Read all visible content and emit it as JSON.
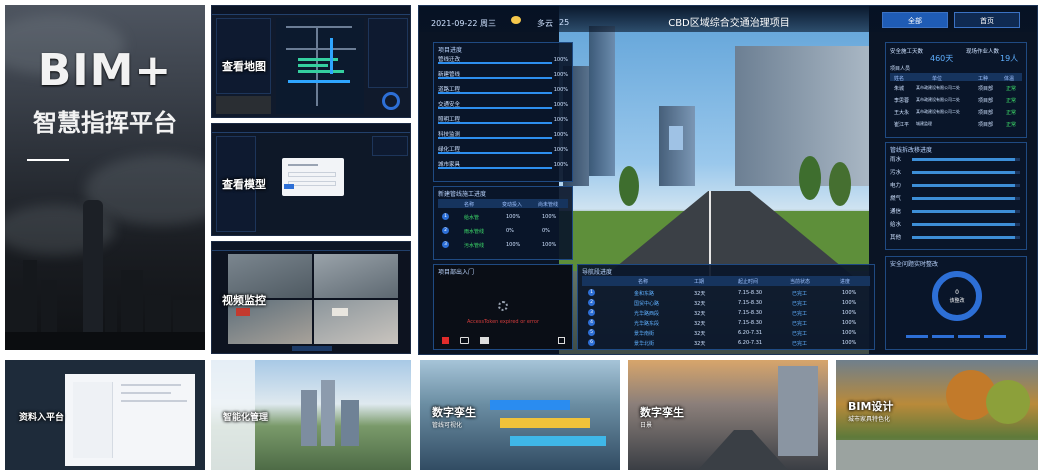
{
  "hero": {
    "title": "BIM+",
    "subtitle": "智慧指挥平台"
  },
  "modules": {
    "map": {
      "label": "查看地图"
    },
    "model": {
      "label": "查看模型"
    },
    "video": {
      "label": "视频监控"
    }
  },
  "dashboard": {
    "date": "2021-09-22 周三",
    "weather": "多云",
    "temperature": "25",
    "project_title": "CBD区域综合交通治理项目",
    "tabs": {
      "all": "全部",
      "home": "首页"
    },
    "project_progress": {
      "title": "项目进度",
      "items": [
        {
          "label": "管线迁改",
          "percent": "100%",
          "value": 1.0
        },
        {
          "label": "新建管线",
          "percent": "100%",
          "value": 1.0
        },
        {
          "label": "道路工程",
          "percent": "100%",
          "value": 1.0
        },
        {
          "label": "交通安全",
          "percent": "100%",
          "value": 1.0
        },
        {
          "label": "照明工程",
          "percent": "100%",
          "value": 1.0
        },
        {
          "label": "科技监测",
          "percent": "100%",
          "value": 1.0
        },
        {
          "label": "绿化工程",
          "percent": "100%",
          "value": 1.0
        },
        {
          "label": "城市家具",
          "percent": "100%",
          "value": 1.0
        }
      ]
    },
    "new_pipeline": {
      "title": "新建管线施工进度",
      "headers": [
        "名称",
        "变动投入",
        "尚未管线"
      ],
      "rows": [
        {
          "num": "1",
          "name": "给水管",
          "a": "100%",
          "b": "100%"
        },
        {
          "num": "2",
          "name": "雨水管线",
          "a": "0%",
          "b": "0%"
        },
        {
          "num": "3",
          "name": "污水管线",
          "a": "100%",
          "b": "100%"
        }
      ]
    },
    "entrance": {
      "title": "项目部出入门",
      "message": "AccessToken expired or error"
    },
    "safety": {
      "label": "安全施工天数",
      "value": "460天",
      "staff_label": "现场作业人数",
      "staff_value": "19人"
    },
    "personnel": {
      "title": "项目人员",
      "headers": [
        "姓名",
        "单位",
        "工种",
        "体温"
      ],
      "rows": [
        {
          "name": "朱城",
          "unit": "某市政建设有限公司二处",
          "role": "项目部",
          "temp": "正常"
        },
        {
          "name": "李思蓉",
          "unit": "某市政建设有限公司二处",
          "role": "项目部",
          "temp": "正常"
        },
        {
          "name": "王大永",
          "unit": "某市政建设有限公司二处",
          "role": "项目部",
          "temp": "正常"
        },
        {
          "name": "崔江平",
          "unit": "城建监理",
          "role": "项目部",
          "temp": "正常"
        }
      ]
    },
    "relocation": {
      "title": "管线拆改移进度",
      "items": [
        {
          "label": "雨水",
          "value": 0.95
        },
        {
          "label": "污水",
          "value": 0.95
        },
        {
          "label": "电力",
          "value": 0.95
        },
        {
          "label": "燃气",
          "value": 0.95
        },
        {
          "label": "通信",
          "value": 0.95
        },
        {
          "label": "给水",
          "value": 0.95
        },
        {
          "label": "其他",
          "value": 0.95
        }
      ]
    },
    "route": {
      "title": "导航段进度",
      "headers": [
        "名称",
        "工期",
        "起止时间",
        "当前状态",
        "进度"
      ],
      "rows": [
        {
          "num": "1",
          "name": "金和东路",
          "days": "32天",
          "range": "7.15-8.30",
          "status": "已完工",
          "pct": "100%"
        },
        {
          "num": "2",
          "name": "国贸中心路",
          "days": "32天",
          "range": "7.15-8.30",
          "status": "已完工",
          "pct": "100%"
        },
        {
          "num": "3",
          "name": "光华路西段",
          "days": "32天",
          "range": "7.15-8.30",
          "status": "已完工",
          "pct": "100%"
        },
        {
          "num": "4",
          "name": "光华路东段",
          "days": "32天",
          "range": "7.15-8.30",
          "status": "已完工",
          "pct": "100%"
        },
        {
          "num": "5",
          "name": "景华南街",
          "days": "32天",
          "range": "6.20-7.31",
          "status": "已完工",
          "pct": "100%"
        },
        {
          "num": "6",
          "name": "景华北街",
          "days": "32天",
          "range": "6.20-7.31",
          "status": "已完工",
          "pct": "100%"
        }
      ]
    },
    "hazard": {
      "title": "安全问题实时整改",
      "center_value": "0",
      "center_label": "该整改"
    }
  },
  "bottom": {
    "data_platform": {
      "label": "资料入平台"
    },
    "smart_mgmt": {
      "label": "智能化管理"
    },
    "twin_pipeline": {
      "label": "数字孪生",
      "sub": "管线可视化"
    },
    "twin_day": {
      "label": "数字孪生",
      "sub": "日景"
    },
    "bim_design": {
      "label": "BIM设计",
      "sub": "城市家具特色化"
    }
  }
}
